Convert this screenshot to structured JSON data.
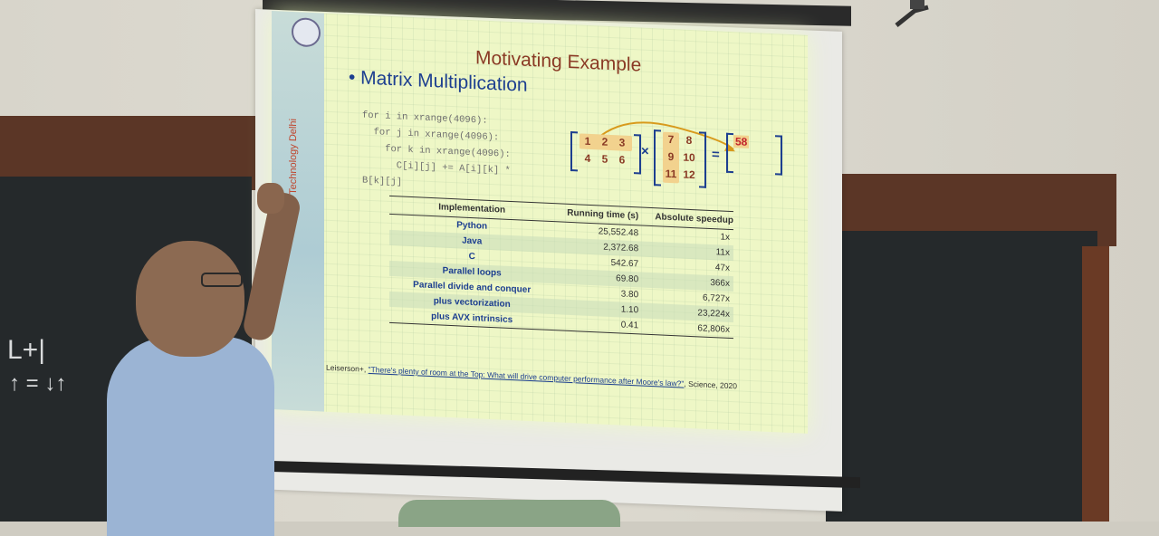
{
  "slide": {
    "title": "Motivating Example",
    "bullet": "• Matrix Multiplication",
    "ribbon_text": "of Technology Delhi",
    "code_lines": [
      "for i in xrange(4096):",
      "  for j in xrange(4096):",
      "    for k in xrange(4096):",
      "      C[i][j] += A[i][k] *",
      "B[k][j]"
    ],
    "matrix_a": [
      [
        "1",
        "2",
        "3"
      ],
      [
        "4",
        "5",
        "6"
      ]
    ],
    "matrix_b": [
      [
        "7",
        "8"
      ],
      [
        "9",
        "10"
      ],
      [
        "11",
        "12"
      ]
    ],
    "result_value": "58",
    "times_symbol": "×",
    "equals_symbol": "=",
    "table": {
      "headers": [
        "Implementation",
        "Running time (s)",
        "Absolute speedup"
      ],
      "rows": [
        {
          "impl": "Python",
          "time": "25,552.48",
          "speedup": "1x"
        },
        {
          "impl": "Java",
          "time": "2,372.68",
          "speedup": "11x"
        },
        {
          "impl": "C",
          "time": "542.67",
          "speedup": "47x"
        },
        {
          "impl": "Parallel loops",
          "time": "69.80",
          "speedup": "366x"
        },
        {
          "impl": "Parallel divide and conquer",
          "time": "3.80",
          "speedup": "6,727x"
        },
        {
          "impl": "plus vectorization",
          "time": "1.10",
          "speedup": "23,224x"
        },
        {
          "impl": "plus AVX intrinsics",
          "time": "0.41",
          "speedup": "62,806x"
        }
      ]
    },
    "citation_prefix": "Leiserson+, ",
    "citation_link": "\"There's plenty of room at the Top: What will drive computer performance after Moore's law?\"",
    "citation_suffix": ", Science, 2020"
  },
  "colors": {
    "slide_bg": "#eef7c6",
    "title": "#8a3a25",
    "accent_blue": "#1d3f90",
    "blackboard": "#25292b",
    "wood": "#5b3626"
  }
}
